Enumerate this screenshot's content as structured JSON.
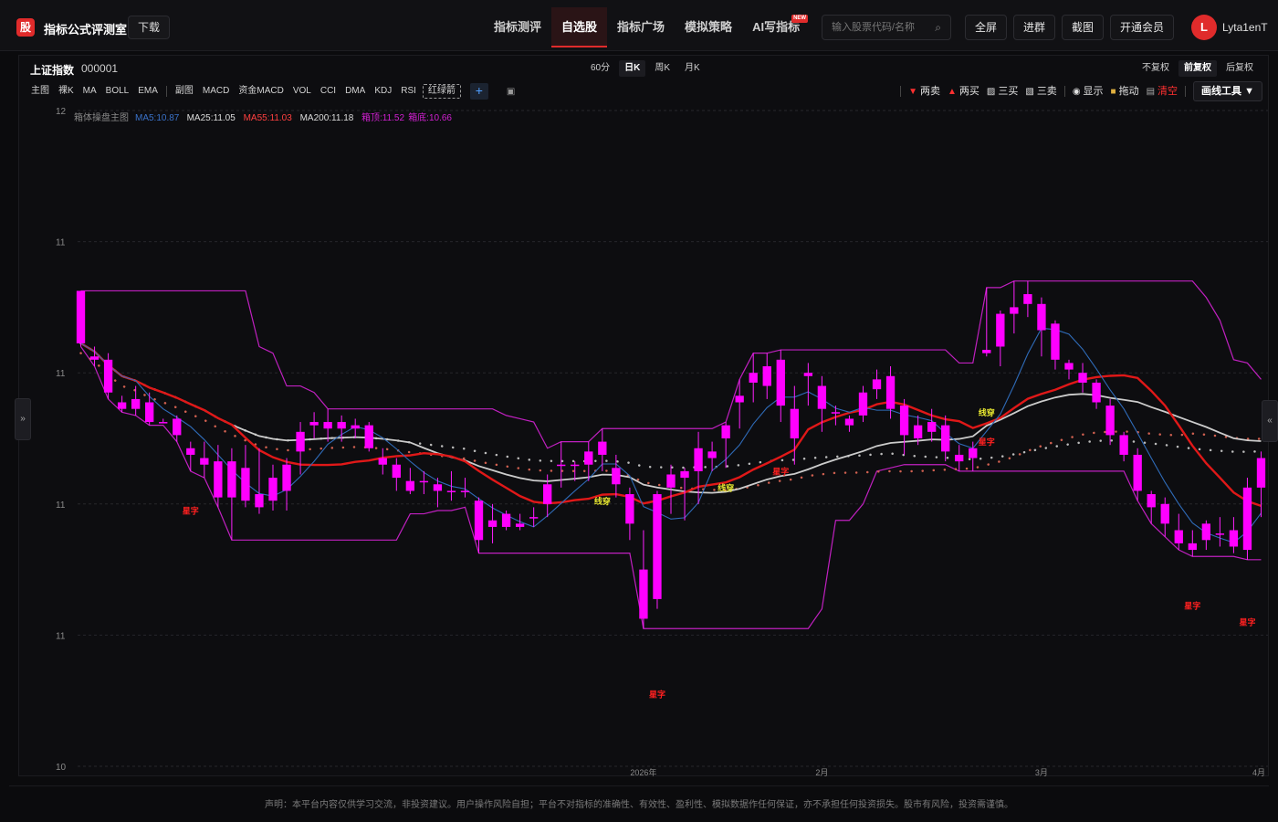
{
  "app": {
    "logo_char": "股",
    "brand": "指标公式评测室",
    "download": "下载"
  },
  "nav": [
    {
      "label": "指标测评",
      "active": false
    },
    {
      "label": "自选股",
      "active": true
    },
    {
      "label": "指标广场",
      "active": false
    },
    {
      "label": "模拟策略",
      "active": false
    },
    {
      "label": "AI写指标",
      "active": false,
      "badge": "NEW"
    }
  ],
  "search": {
    "placeholder": "输入股票代码/名称",
    "icon": "search-icon"
  },
  "top_buttons": [
    "全屏",
    "进群",
    "截图",
    "开通会员"
  ],
  "user": {
    "avatar": "L",
    "name": "Lyta1enT"
  },
  "stock": {
    "name": "上证指数",
    "code": "000001"
  },
  "periods": [
    {
      "label": "60分",
      "active": false
    },
    {
      "label": "日K",
      "active": true
    },
    {
      "label": "周K",
      "active": false
    },
    {
      "label": "月K",
      "active": false
    }
  ],
  "adjust": [
    {
      "label": "不复权",
      "active": false
    },
    {
      "label": "前复权",
      "active": true
    },
    {
      "label": "后复权",
      "active": false
    }
  ],
  "indicator_tools": {
    "main": [
      "主图",
      "裸K",
      "MA",
      "BOLL",
      "EMA"
    ],
    "sub": [
      "副图",
      "MACD",
      "资金MACD",
      "VOL",
      "CCI",
      "DMA",
      "KDJ",
      "RSI"
    ],
    "active_custom": "红绿箭",
    "add": "+"
  },
  "draw_tools": [
    {
      "label": "两卖",
      "glyph": "▼",
      "color": "#ff3030"
    },
    {
      "label": "两买",
      "glyph": "▲",
      "color": "#ff3030"
    },
    {
      "label": "三买",
      "glyph": "▨",
      "color": "#dddddd"
    },
    {
      "label": "三卖",
      "glyph": "▧",
      "color": "#dddddd"
    },
    {
      "label": "显示",
      "glyph": "◉",
      "color": "#dddddd"
    },
    {
      "label": "拖动",
      "glyph": "🔒",
      "color": "#dddddd"
    },
    {
      "label": "清空",
      "glyph": "🗑",
      "color": "#ff3030"
    }
  ],
  "draw_menu": "画线工具 ▼",
  "legend": {
    "main_name": "箱体操盘主图",
    "items": [
      {
        "text": "MA5:10.87",
        "color": "#3a72c9"
      },
      {
        "text": "MA25:11.05",
        "color": "#dddddd"
      },
      {
        "text": "MA55:11.03",
        "color": "#ff4040"
      },
      {
        "text": "MA200:11.18",
        "color": "#dddddd"
      },
      {
        "text": "箱顶:11.52",
        "color": "#d020d0"
      },
      {
        "text": "箱底:10.66",
        "color": "#d020d0"
      }
    ]
  },
  "chart_data": {
    "type": "candlestick",
    "y_tick_labels": [
      "12",
      "11",
      "11",
      "11",
      "11",
      "10"
    ],
    "x_tick_labels": [
      "2026年",
      "2月",
      "3月",
      "4月"
    ],
    "candles": [
      [
        11.45,
        11.29,
        11.45,
        11.28
      ],
      [
        11.25,
        11.24,
        11.28,
        11.22
      ],
      [
        11.24,
        11.14,
        11.26,
        11.12
      ],
      [
        11.11,
        11.09,
        11.13,
        11.08
      ],
      [
        11.09,
        11.12,
        11.16,
        11.07
      ],
      [
        11.11,
        11.05,
        11.14,
        11.04
      ],
      [
        11.05,
        11.05,
        11.06,
        11.05
      ],
      [
        11.06,
        11.01,
        11.07,
        10.99
      ],
      [
        10.97,
        10.95,
        10.99,
        10.9
      ],
      [
        10.94,
        10.92,
        10.99,
        10.88
      ],
      [
        10.93,
        10.82,
        10.98,
        10.79
      ],
      [
        10.93,
        10.82,
        10.97,
        10.69
      ],
      [
        10.91,
        10.81,
        10.98,
        10.79
      ],
      [
        10.83,
        10.79,
        10.97,
        10.77
      ],
      [
        10.81,
        10.88,
        10.92,
        10.78
      ],
      [
        10.84,
        10.92,
        10.94,
        10.78
      ],
      [
        10.96,
        11.02,
        11.05,
        10.89
      ],
      [
        11.05,
        11.04,
        11.08,
        11.0
      ],
      [
        11.03,
        11.05,
        11.09,
        10.99
      ],
      [
        11.05,
        11.03,
        11.07,
        10.99
      ],
      [
        11.03,
        11.04,
        11.06,
        11.0
      ],
      [
        11.04,
        10.97,
        11.05,
        10.96
      ],
      [
        10.94,
        10.92,
        10.97,
        10.89
      ],
      [
        10.92,
        10.88,
        10.94,
        10.84
      ],
      [
        10.87,
        10.84,
        10.91,
        10.83
      ],
      [
        10.87,
        10.87,
        10.9,
        10.83
      ],
      [
        10.86,
        10.84,
        10.88,
        10.79
      ],
      [
        10.84,
        10.84,
        10.9,
        10.81
      ],
      [
        10.84,
        10.84,
        10.88,
        10.82
      ],
      [
        10.81,
        10.69,
        10.82,
        10.65
      ],
      [
        10.75,
        10.73,
        10.8,
        10.68
      ],
      [
        10.77,
        10.73,
        10.78,
        10.72
      ],
      [
        10.73,
        10.74,
        10.77,
        10.72
      ],
      [
        10.76,
        10.76,
        10.79,
        10.73
      ],
      [
        10.8,
        10.86,
        10.89,
        10.76
      ],
      [
        10.92,
        10.92,
        10.99,
        10.85
      ],
      [
        10.92,
        10.92,
        10.93,
        10.87
      ],
      [
        10.96,
        10.92,
        10.99,
        10.87
      ],
      [
        10.95,
        10.99,
        11.03,
        10.9
      ],
      [
        10.91,
        10.86,
        10.95,
        10.82
      ],
      [
        10.83,
        10.74,
        10.85,
        10.69
      ],
      [
        10.6,
        10.45,
        10.72,
        10.42
      ],
      [
        10.51,
        10.83,
        10.84,
        10.48
      ],
      [
        10.85,
        10.89,
        10.92,
        10.77
      ],
      [
        10.9,
        10.88,
        10.91,
        10.75
      ],
      [
        10.9,
        10.97,
        11.02,
        10.8
      ],
      [
        10.96,
        10.94,
        10.99,
        10.9
      ],
      [
        11.04,
        11.0,
        11.05,
        10.91
      ],
      [
        11.13,
        11.11,
        11.18,
        11.03
      ],
      [
        11.17,
        11.2,
        11.26,
        11.11
      ],
      [
        11.16,
        11.22,
        11.26,
        11.12
      ],
      [
        11.24,
        11.1,
        11.27,
        11.05
      ],
      [
        11.09,
        11.0,
        11.16,
        10.92
      ],
      [
        11.2,
        11.19,
        11.23,
        11.1
      ],
      [
        11.16,
        11.09,
        11.19,
        11.02
      ],
      [
        11.08,
        11.08,
        11.1,
        11.04
      ],
      [
        11.06,
        11.04,
        11.07,
        11.02
      ],
      [
        11.14,
        11.07,
        11.16,
        11.05
      ],
      [
        11.18,
        11.15,
        11.21,
        11.12
      ],
      [
        11.19,
        11.09,
        11.22,
        11.06
      ],
      [
        11.1,
        11.01,
        11.12,
        10.95
      ],
      [
        11.04,
        11.0,
        11.07,
        10.98
      ],
      [
        11.05,
        11.02,
        11.09,
        10.99
      ],
      [
        11.04,
        10.96,
        11.07,
        10.93
      ],
      [
        10.95,
        10.93,
        10.98,
        10.9
      ],
      [
        10.97,
        10.94,
        10.99,
        10.9
      ],
      [
        11.27,
        11.26,
        11.46,
        11.25
      ],
      [
        11.38,
        11.28,
        11.39,
        11.22
      ],
      [
        11.38,
        11.4,
        11.48,
        11.32
      ],
      [
        11.44,
        11.41,
        11.48,
        11.37
      ],
      [
        11.41,
        11.33,
        11.43,
        11.25
      ],
      [
        11.35,
        11.24,
        11.36,
        11.21
      ],
      [
        11.23,
        11.21,
        11.24,
        11.18
      ],
      [
        11.2,
        11.17,
        11.23,
        11.14
      ],
      [
        11.17,
        11.11,
        11.18,
        11.09
      ],
      [
        11.1,
        11.01,
        11.12,
        10.98
      ],
      [
        11.01,
        10.95,
        11.02,
        10.93
      ],
      [
        10.95,
        10.84,
        10.97,
        10.81
      ],
      [
        10.83,
        10.79,
        10.84,
        10.74
      ],
      [
        10.8,
        10.74,
        10.82,
        10.7
      ],
      [
        10.72,
        10.68,
        10.77,
        10.66
      ],
      [
        10.68,
        10.66,
        10.72,
        10.64
      ],
      [
        10.74,
        10.69,
        10.75,
        10.66
      ],
      [
        10.71,
        10.71,
        10.76,
        10.67
      ],
      [
        10.72,
        10.67,
        10.76,
        10.65
      ],
      [
        10.66,
        10.85,
        10.88,
        10.63
      ],
      [
        10.85,
        10.94,
        10.96,
        10.76
      ]
    ],
    "lines": {
      "box_color": "#c020c0",
      "ma5_color": "#2f6bb8",
      "ma25_color": "#cccccc",
      "ma55_color": "#e01818"
    },
    "signals": [
      {
        "text": "星字",
        "color": "#ff2020",
        "i": 8,
        "y": 10.77
      },
      {
        "text": "线穿",
        "color": "#e8e830",
        "i": 38,
        "y": 10.8
      },
      {
        "text": "星字",
        "color": "#ff2020",
        "i": 42,
        "y": 10.21
      },
      {
        "text": "线穿",
        "color": "#e8e830",
        "i": 47,
        "y": 10.84
      },
      {
        "text": "星字",
        "color": "#ff2020",
        "i": 51,
        "y": 10.89
      },
      {
        "text": "线穿",
        "color": "#e8e830",
        "i": 66,
        "y": 11.07
      },
      {
        "text": "星字",
        "color": "#ff2020",
        "i": 66,
        "y": 10.98
      },
      {
        "text": "星字",
        "color": "#ff2020",
        "i": 81,
        "y": 10.48
      },
      {
        "text": "星字",
        "color": "#ff2020",
        "i": 85,
        "y": 10.43
      }
    ]
  },
  "side_arrows": {
    "left": "»",
    "right": "«"
  },
  "footer": "声明：本平台内容仅供学习交流，非投资建议。用户操作风险自担；平台不对指标的准确性、有效性、盈利性、模拟数据作任何保证，亦不承担任何投资损失。股市有风险，投资需谨慎。"
}
